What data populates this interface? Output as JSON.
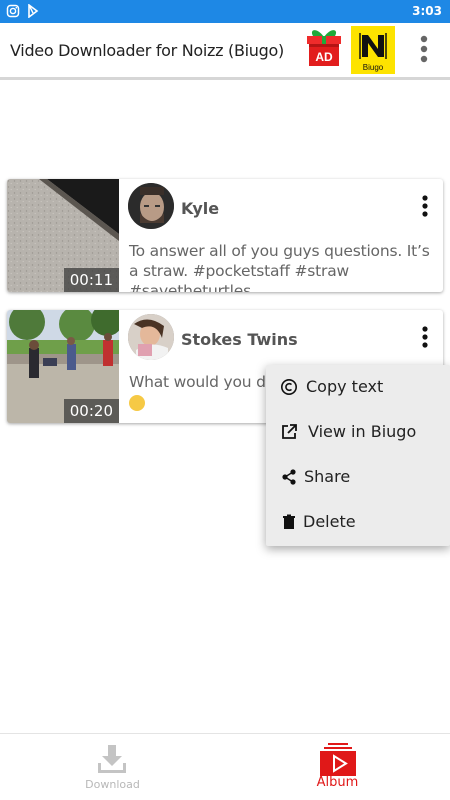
{
  "status_bar": {
    "time": "3:03",
    "icons": [
      "instagram-icon",
      "play-store-icon"
    ]
  },
  "app_bar": {
    "title": "Video Downloader for Noizz (Biugo)",
    "ad_label": "AD",
    "biugo_label": "Biugo",
    "icons": [
      "gift-ad-icon",
      "noizz-logo-icon",
      "more-vert-icon"
    ]
  },
  "videos": [
    {
      "username": "Kyle",
      "caption": "To answer all of you guys questions. It’s a straw. #pocketstaff #straw #savetheturtles",
      "duration": "00:11"
    },
    {
      "username": "Stokes Twins",
      "caption": "What would you do i",
      "duration": "00:20"
    }
  ],
  "context_menu": {
    "items": [
      {
        "label": "Copy text",
        "icon": "copyright-icon"
      },
      {
        "label": "View in Biugo",
        "icon": "external-link-icon"
      },
      {
        "label": "Share",
        "icon": "share-icon"
      },
      {
        "label": "Delete",
        "icon": "trash-icon"
      }
    ]
  },
  "bottom_nav": {
    "download_label": "Download",
    "album_label": "Album",
    "active": "Album"
  },
  "colors": {
    "status_bar": "#1e88e5",
    "accent_red": "#e01818",
    "biugo_yellow": "#fde300",
    "menu_bg": "#ececec"
  }
}
